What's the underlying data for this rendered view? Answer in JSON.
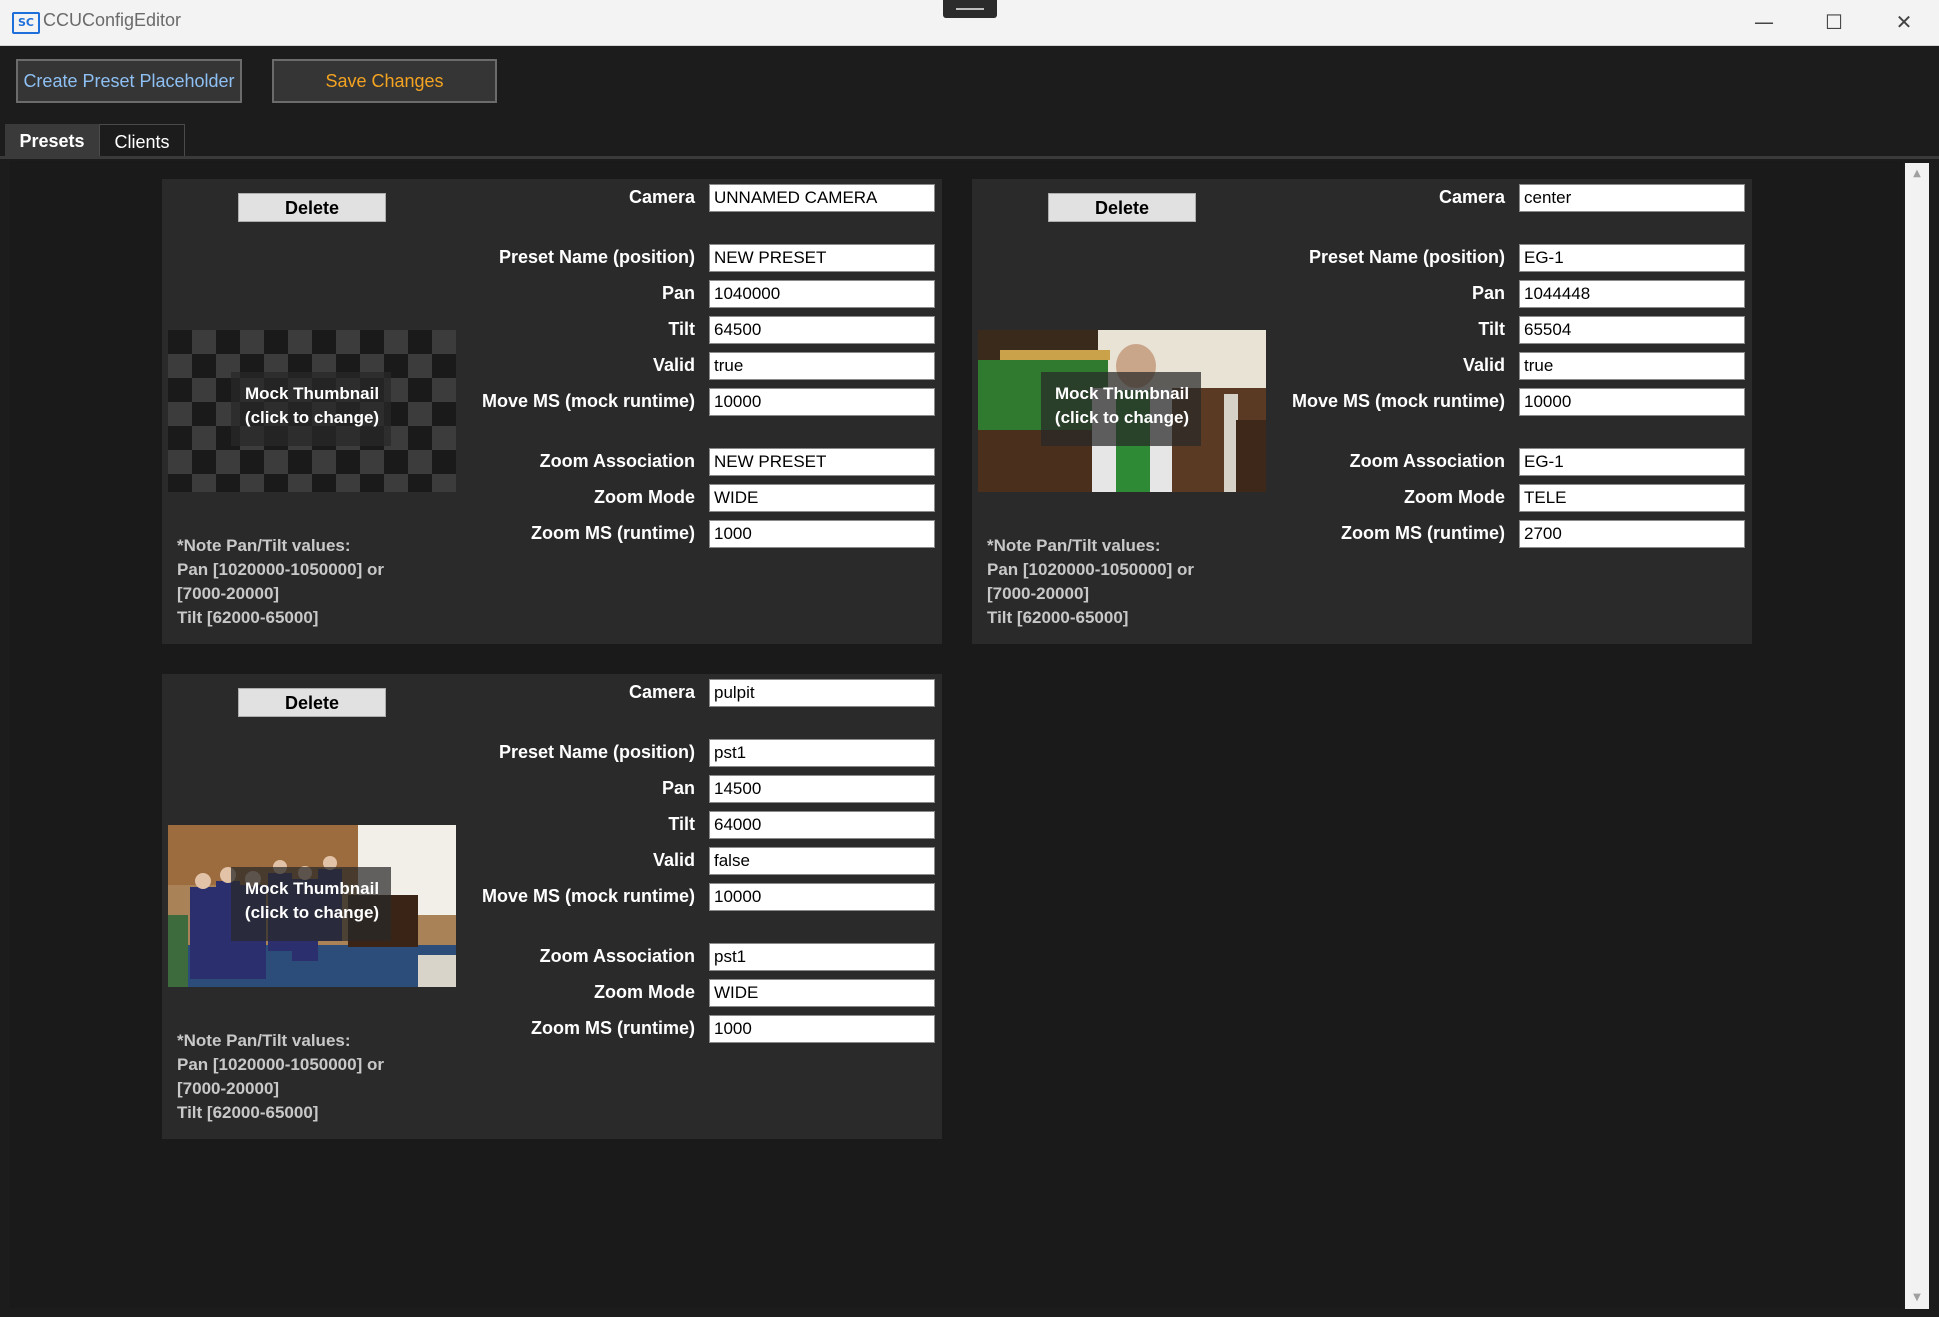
{
  "window": {
    "title": "CCUConfigEditor",
    "icon_text": "SC",
    "controls": {
      "minimize": "—",
      "maximize": "☐",
      "close": "✕"
    }
  },
  "toolbar": {
    "create_label": "Create Preset Placeholder",
    "save_label": "Save Changes"
  },
  "tabs": [
    {
      "label": "Presets",
      "selected": true
    },
    {
      "label": "Clients",
      "selected": false
    }
  ],
  "scrollbar": {
    "up": "▲",
    "down": "▼"
  },
  "labels": {
    "delete": "Delete",
    "camera": "Camera",
    "preset_name": "Preset Name (position)",
    "pan": "Pan",
    "tilt": "Tilt",
    "valid": "Valid",
    "move_ms": "Move MS (mock runtime)",
    "zoom_association": "Zoom Association",
    "zoom_mode": "Zoom Mode",
    "zoom_ms": "Zoom MS (runtime)",
    "thumb_line1": "Mock Thumbnail",
    "thumb_line2": "(click to change)",
    "note_l1": "*Note Pan/Tilt values:",
    "note_l2": "Pan [1020000-1050000] or",
    "note_l3": "[7000-20000]",
    "note_l4": "Tilt [62000-65000]"
  },
  "presets": [
    {
      "camera": "UNNAMED CAMERA",
      "preset_name": "NEW PRESET",
      "pan": "1040000",
      "tilt": "64500",
      "valid": "true",
      "move_ms": "10000",
      "zoom_association": "NEW PRESET",
      "zoom_mode": "WIDE",
      "zoom_ms": "1000",
      "thumbnail": "checkerboard placeholder"
    },
    {
      "camera": "center",
      "preset_name": "EG-1",
      "pan": "1044448",
      "tilt": "65504",
      "valid": "true",
      "move_ms": "10000",
      "zoom_association": "EG-1",
      "zoom_mode": "TELE",
      "zoom_ms": "2700",
      "thumbnail": "pastor at altar photo"
    },
    {
      "camera": "pulpit",
      "preset_name": "pst1",
      "pan": "14500",
      "tilt": "64000",
      "valid": "false",
      "move_ms": "10000",
      "zoom_association": "pst1",
      "zoom_mode": "WIDE",
      "zoom_ms": "1000",
      "thumbnail": "choir in church photo"
    }
  ]
}
